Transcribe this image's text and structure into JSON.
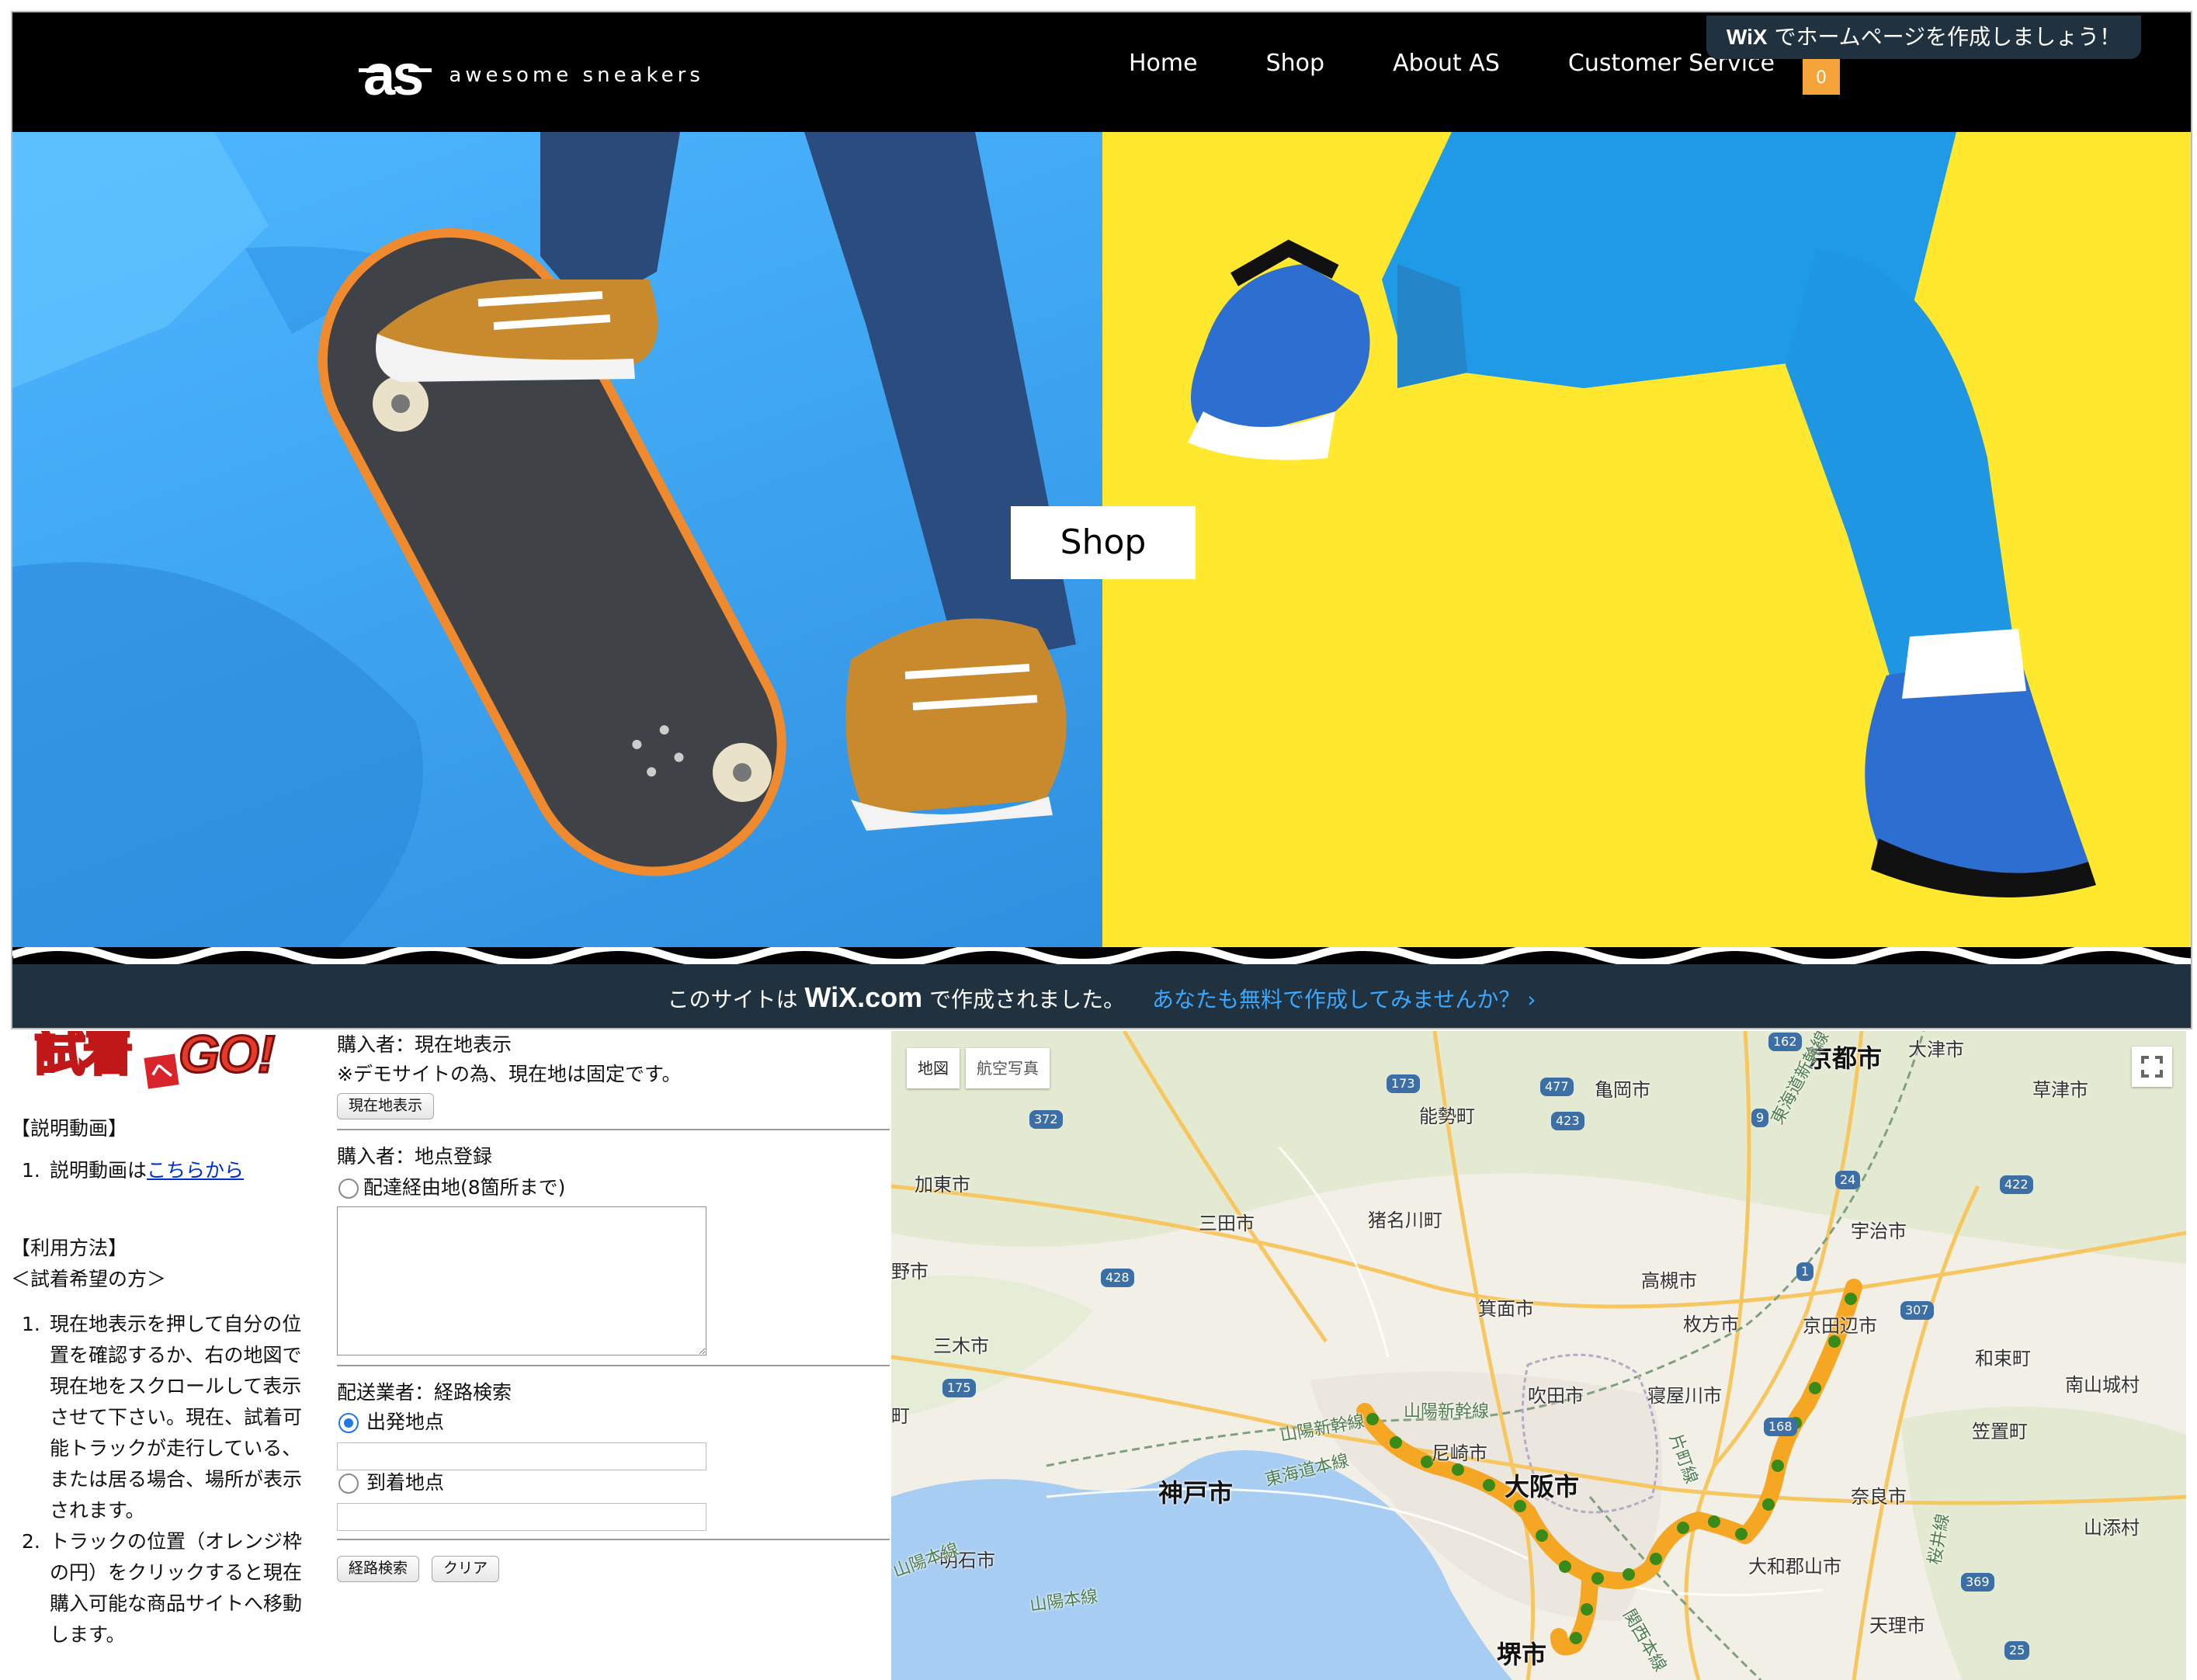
{
  "wix_site": {
    "logo_mark": "as",
    "logo_text": "awesome sneakers",
    "nav": [
      "Home",
      "Shop",
      "About AS",
      "Customer Service"
    ],
    "cart_count": "0",
    "badge": {
      "brand": "WiX",
      "text": "でホームページを作成しましょう！"
    },
    "hero_button": "Shop",
    "footer": {
      "prefix": "このサイトは",
      "brand": "WiX.com",
      "suffix": "で作成されました。",
      "cta": "あなたも無料で作成してみませんか？ ›"
    }
  },
  "app": {
    "logo": {
      "part1": "試着",
      "part2": "へ",
      "part3": "GO!"
    },
    "explain_video": {
      "heading": "【説明動画】",
      "item_number": "1.",
      "item_prefix": "説明動画は",
      "item_link": "こちらから"
    },
    "usage": {
      "heading": "【利用方法】",
      "subheading": "＜試着希望の方＞",
      "steps": [
        {
          "num": "1.",
          "lines": [
            "現在地表示を押して自分の位",
            "置を確認するか、右の地図で",
            "現在地をスクロールして表示",
            "させて下さい。現在、試着可",
            "能トラックが走行している、",
            "または居る場合、場所が表示",
            "されます。"
          ]
        },
        {
          "num": "2.",
          "lines": [
            "トラックの位置（オレンジ枠",
            "の円）をクリックすると現在",
            "購入可能な商品サイトへ移動",
            "します。"
          ]
        }
      ]
    },
    "buyer_location": {
      "title": "購入者：現在地表示",
      "note": "※デモサイトの為、現在地は固定です。",
      "button": "現在地表示"
    },
    "buyer_points": {
      "title": "購入者：地点登録",
      "radio_label": "配達経由地(8箇所まで)",
      "textarea_value": ""
    },
    "courier": {
      "title": "配送業者：経路検索",
      "origin_label": "出発地点",
      "origin_value": "",
      "destination_label": "到着地点",
      "destination_value": "",
      "search_button": "経路検索",
      "clear_button": "クリア"
    },
    "map": {
      "type_map": "地図",
      "type_satellite": "航空写真",
      "route_color": "#f5a623",
      "dot_color": "#3a8a1a",
      "labels": [
        "京都市",
        "大津市",
        "亀岡市",
        "草津市",
        "能勢町",
        "加東市",
        "三田市",
        "猪名川町",
        "宇治市",
        "高槻市",
        "箕面市",
        "枚方市",
        "京田辺市",
        "野市",
        "三木市",
        "和束町",
        "南山城村",
        "吹田市",
        "寝屋川市",
        "笠置町",
        "尼崎市",
        "神戸市",
        "大阪市",
        "奈良市",
        "明石市",
        "大和郡山市",
        "山添村",
        "堺市",
        "天理市",
        "町"
      ],
      "rail_labels": [
        "東海道新幹線",
        "山陽新幹線",
        "山陽新幹線",
        "東海道本線",
        "山陽本線",
        "山陽本線",
        "片町線",
        "関西本線",
        "桜井線"
      ],
      "road_numbers": [
        "162",
        "173",
        "477",
        "423",
        "9",
        "372",
        "24",
        "422",
        "428",
        "1",
        "307",
        "175",
        "168",
        "369",
        "25"
      ]
    }
  }
}
